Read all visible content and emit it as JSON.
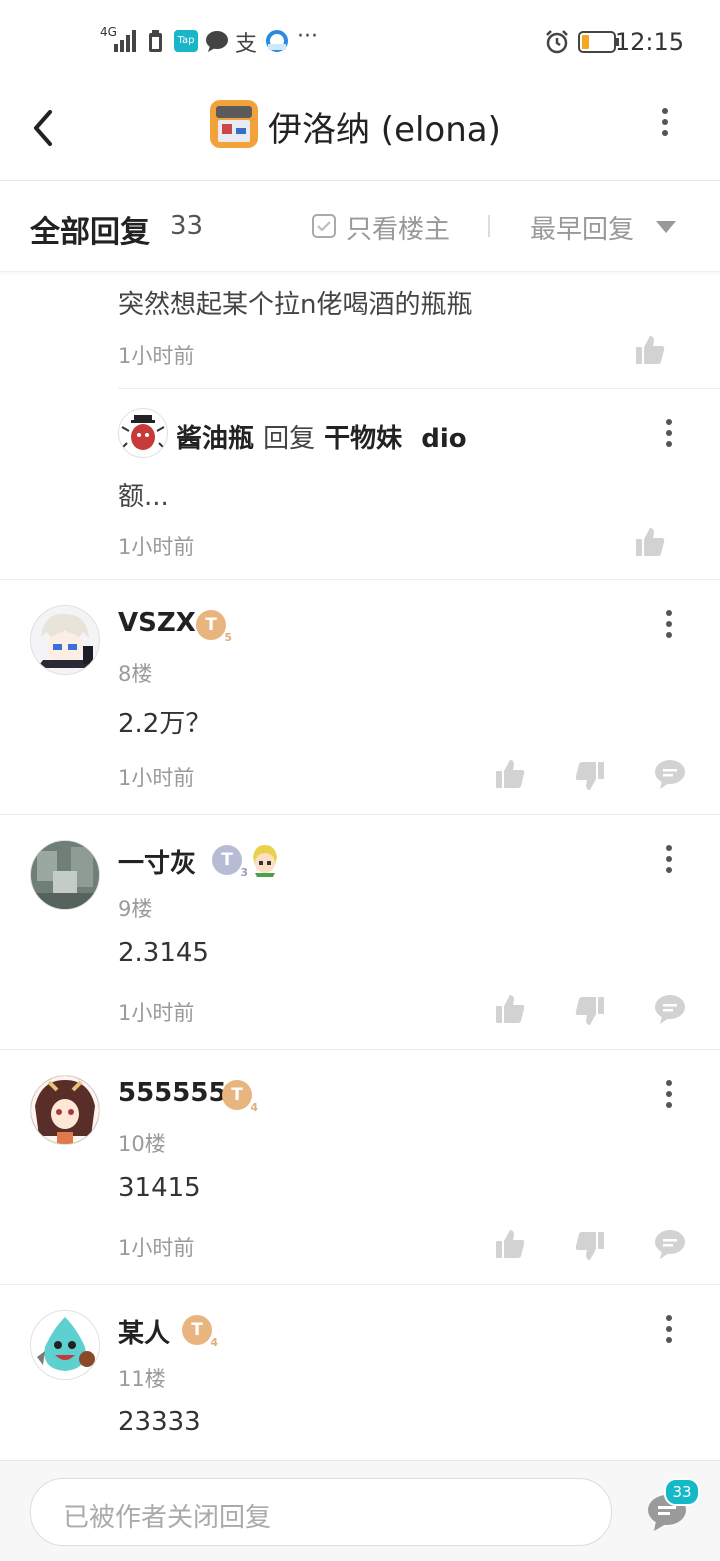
{
  "status_bar": {
    "network": "4G",
    "time": "12:15",
    "app_icons": [
      "tap-icon",
      "message-icon",
      "alipay-icon",
      "browser-icon",
      "more-icon"
    ]
  },
  "header": {
    "title": "伊洛纳 (elona)"
  },
  "tabs": {
    "all_replies": "全部回复",
    "reply_count": "33",
    "only_op": "只看楼主",
    "sort": "最早回复"
  },
  "thread": {
    "partial_reply": {
      "text": "突然想起某个拉n佬喝酒的瓶瓶",
      "time": "1小时前"
    },
    "sub_reply": {
      "author": "酱油瓶",
      "reply_word": "回复",
      "target": "干物妹",
      "target_suffix": "dio",
      "text": "额...",
      "time": "1小时前"
    }
  },
  "posts": [
    {
      "username": "VSZX",
      "badge_level": "5",
      "floor": "8楼",
      "content": "2.2万？",
      "time": "1小时前"
    },
    {
      "username": "一寸灰",
      "badge_level": "3",
      "floor": "9楼",
      "content": "2.3145",
      "time": "1小时前"
    },
    {
      "username": "555555",
      "badge_level": "4",
      "floor": "10楼",
      "content": "31415",
      "time": "1小时前"
    },
    {
      "username": "某人",
      "badge_level": "4",
      "floor": "11楼",
      "content": "23333"
    }
  ],
  "badge_letter": "T",
  "bottom": {
    "closed_placeholder": "已被作者关闭回复",
    "comment_count": "33"
  },
  "colors": {
    "accent": "#14b9c8",
    "badge_gold": "#e9b57e",
    "badge_silver": "#b7bcd4",
    "icon_gray": "#d2d2d2"
  }
}
